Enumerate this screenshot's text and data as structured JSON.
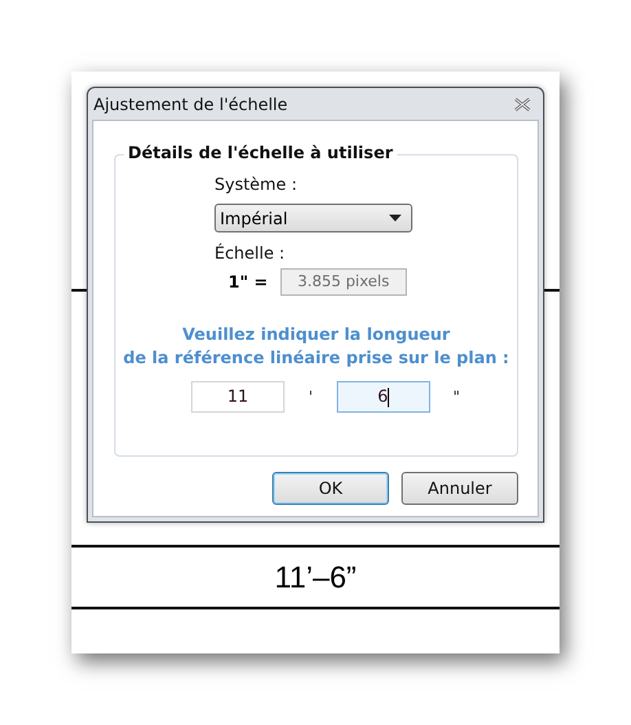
{
  "dialog": {
    "title": "Ajustement de l'échelle",
    "group": {
      "title": "Détails de l'échelle à utiliser",
      "system": {
        "label": "Système :",
        "value": "Impérial"
      },
      "scale": {
        "label": "Échelle :",
        "unit": "1\" =",
        "value": "3.855 pixels",
        "disabled": true
      },
      "prompt": [
        "Veuillez indiquer la longueur",
        "de la référence linéaire prise sur le plan :"
      ],
      "fields": [
        {
          "value": "11",
          "mark": "'",
          "focused": false
        },
        {
          "value": "6",
          "mark": "\"",
          "focused": true
        }
      ]
    },
    "buttons": [
      {
        "label": "OK",
        "default": true
      },
      {
        "label": "Annuler",
        "default": false
      }
    ]
  },
  "plan": {
    "dimension": "11’–6”"
  }
}
